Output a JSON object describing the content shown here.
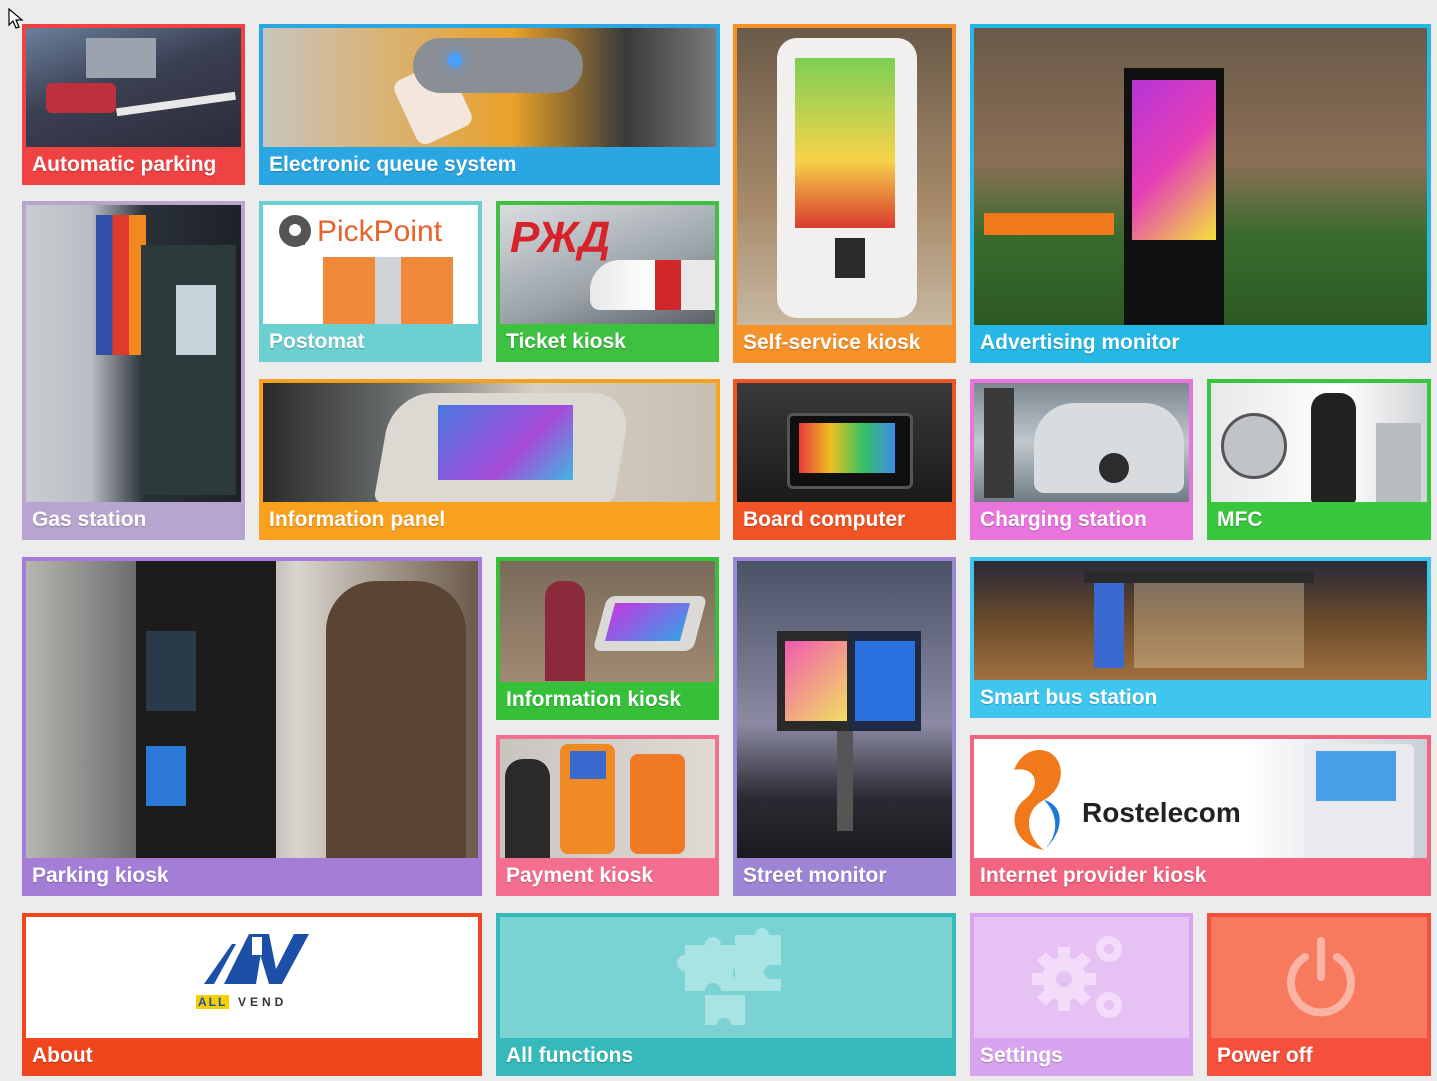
{
  "tiles": {
    "automatic_parking": {
      "label": "Automatic parking",
      "color": "#ef4343"
    },
    "electronic_queue": {
      "label": "Electronic queue system",
      "color": "#2aa6e2"
    },
    "self_service": {
      "label": "Self-service kiosk",
      "color": "#f7922a"
    },
    "advertising": {
      "label": "Advertising monitor",
      "color": "#25b8e4"
    },
    "gas_station": {
      "label": "Gas station",
      "color": "#b7a4cf"
    },
    "postomat": {
      "label": "Postomat",
      "color": "#6ccfd0",
      "logo": "PickPoint"
    },
    "ticket_kiosk": {
      "label": "Ticket kiosk",
      "color": "#3ec040",
      "logo": "РЖД"
    },
    "info_panel": {
      "label": "Information panel",
      "color": "#f9a11d"
    },
    "board_computer": {
      "label": "Board computer",
      "color": "#f05424"
    },
    "charging": {
      "label": "Charging station",
      "color": "#e874dc"
    },
    "mfc": {
      "label": "MFC",
      "color": "#38c63c"
    },
    "parking_kiosk": {
      "label": "Parking kiosk",
      "color": "#a47ed6"
    },
    "info_kiosk": {
      "label": "Information kiosk",
      "color": "#36c03a"
    },
    "payment_kiosk": {
      "label": "Payment kiosk",
      "color": "#f36e8f"
    },
    "street_monitor": {
      "label": "Street monitor",
      "color": "#9b85d4"
    },
    "smart_bus": {
      "label": "Smart bus station",
      "color": "#3fc6ee"
    },
    "internet_kiosk": {
      "label": "Internet provider kiosk",
      "color": "#f2647f",
      "logo": "Rostelecom"
    },
    "about": {
      "label": "About",
      "color": "#f0461e",
      "logo_text": "VEND",
      "logo_highlight": "ALL"
    },
    "all_functions": {
      "label": "All functions",
      "color": "#35b9bb",
      "icon": "puzzle-icon"
    },
    "settings": {
      "label": "Settings",
      "color": "#d9a4ef",
      "icon": "gears-icon"
    },
    "power_off": {
      "label": "Power off",
      "color": "#f5503c",
      "icon": "power-icon"
    }
  }
}
